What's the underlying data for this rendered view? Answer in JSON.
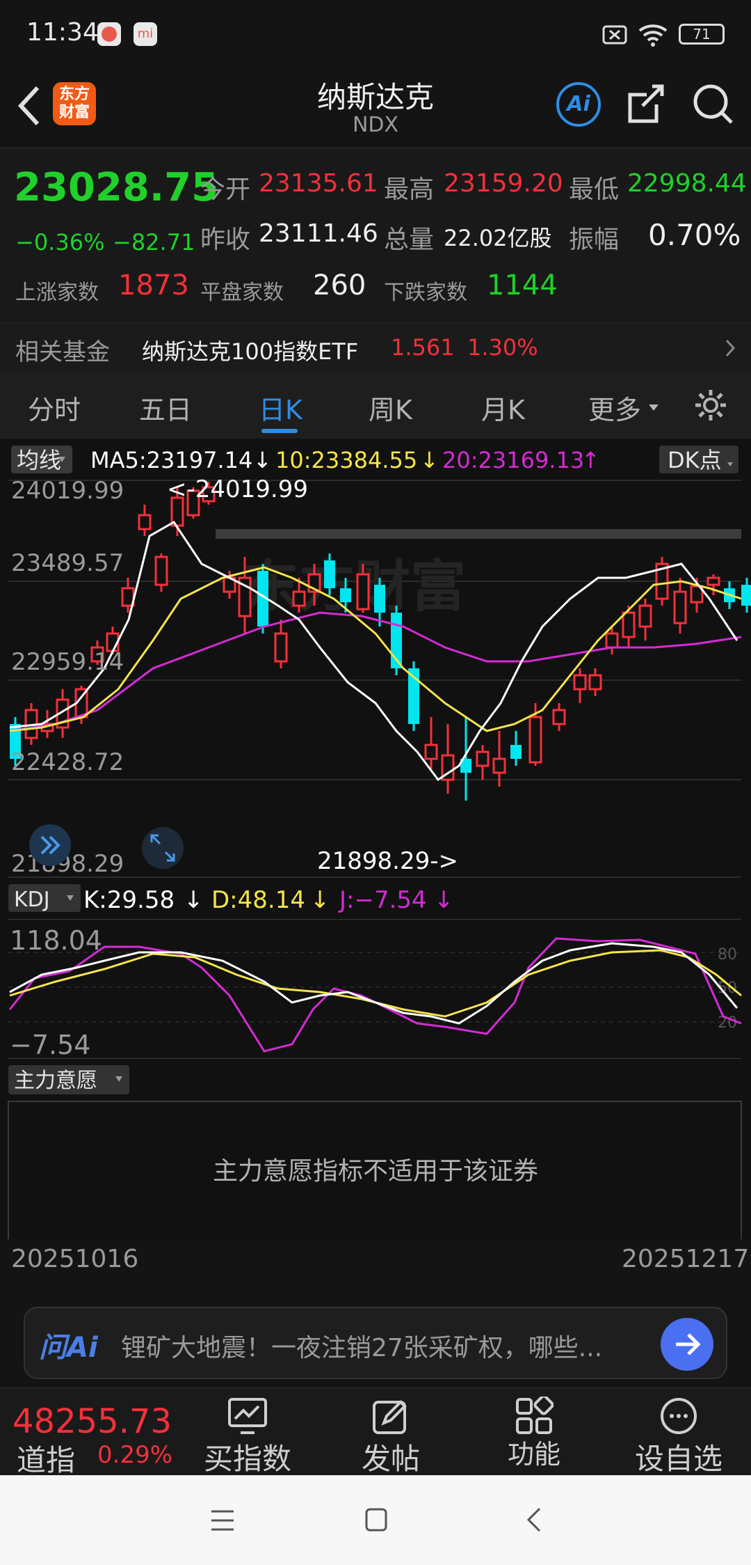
{
  "status": {
    "time": "11:34",
    "battery": "71"
  },
  "header": {
    "title": "纳斯达克",
    "code": "NDX",
    "logo_line1": "东方",
    "logo_line2": "财富",
    "ai_label": "Ai"
  },
  "quote": {
    "price": "23028.75",
    "change_pct": "−0.36%",
    "change_abs": "−82.71",
    "open_label": "今开",
    "open": "23135.61",
    "high_label": "最高",
    "high": "23159.20",
    "low_label": "最低",
    "low": "22998.44",
    "prev_label": "昨收",
    "prev": "23111.46",
    "vol_label": "总量",
    "vol": "22.02亿股",
    "amp_label": "振幅",
    "amp": "0.70%",
    "up_label": "上涨家数",
    "up": "1873",
    "flat_label": "平盘家数",
    "flat": "260",
    "down_label": "下跌家数",
    "down": "1144"
  },
  "fund": {
    "label": "相关基金",
    "name": "纳斯达克100指数ETF",
    "price": "1.561",
    "pct": "1.30%"
  },
  "tabs": [
    {
      "label": "分时"
    },
    {
      "label": "五日"
    },
    {
      "label": "日K"
    },
    {
      "label": "周K"
    },
    {
      "label": "月K"
    },
    {
      "label": "更多"
    }
  ],
  "ma": {
    "selector": "均线",
    "ma5": "MA5:23197.14",
    "ma10": "10:23384.55",
    "ma20": "20:23169.13",
    "dk": "DK点"
  },
  "price_axis": {
    "labels": [
      "24019.99",
      "23489.57",
      "22959.14",
      "22428.72",
      "21898.29"
    ],
    "max_note": "<-24019.99",
    "min_note": "21898.29->"
  },
  "kdj": {
    "selector": "KDJ",
    "k": "K:29.58",
    "d": "D:48.14",
    "j": "J:−7.54",
    "top": "118.04",
    "bottom": "−7.54",
    "levels": [
      "80",
      "50",
      "20"
    ]
  },
  "force": {
    "selector": "主力意愿",
    "message": "主力意愿指标不适用于该证券"
  },
  "dates": {
    "start": "20251016",
    "end": "20251217"
  },
  "ai_bar": {
    "label": "问Ai",
    "text": "锂矿大地震！一夜注销27张采矿权，哪些..."
  },
  "bottom": {
    "index_value": "48255.73",
    "index_name": "道指",
    "index_pct": "0.29%",
    "items": [
      "买指数",
      "发帖",
      "功能",
      "设自选"
    ]
  },
  "colors": {
    "up": "#f5303a",
    "down": "#1fd12a",
    "candle_down": "#00e5ee",
    "accent": "#2f8de4",
    "ma5": "#ffffff",
    "ma10": "#f5e54a",
    "ma20": "#d62ad6"
  }
}
